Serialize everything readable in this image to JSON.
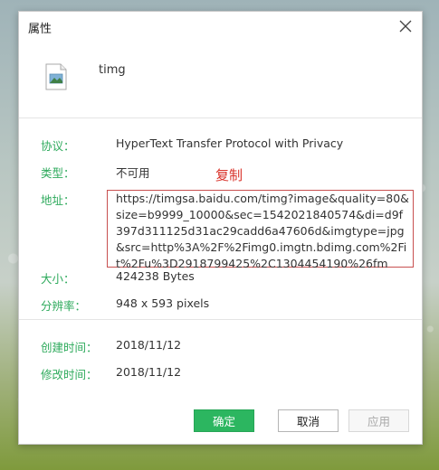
{
  "dialog": {
    "title": "属性",
    "file_name": "timg"
  },
  "properties": {
    "protocol": {
      "label": "协议：",
      "value": "HyperText Transfer Protocol with Privacy"
    },
    "type": {
      "label": "类型：",
      "value": "不可用"
    },
    "address": {
      "label": "地址：",
      "value": "https://timgsa.baidu.com/timg?image&quality=80&size=b9999_10000&sec=1542021840574&di=d9f397d311125d31ac29cadd6a47606d&imgtype=jpg&src=http%3A%2F%2Fimg0.imgtn.bdimg.com%2Fit%2Fu%3D2918799425%2C1304454190%26fm"
    },
    "size": {
      "label": "大小：",
      "value": "424238 Bytes"
    },
    "resolution": {
      "label": "分辨率：",
      "value": "948 x 593 pixels"
    },
    "created": {
      "label": "创建时间：",
      "value": "2018/11/12"
    },
    "modified": {
      "label": "修改时间：",
      "value": "2018/11/12"
    }
  },
  "annotation": {
    "copy_label": "复制"
  },
  "buttons": {
    "ok": "确定",
    "cancel": "取消",
    "apply": "应用"
  },
  "colors": {
    "label_green": "#2eaa5c",
    "ok_green": "#2cb660",
    "annotation_red": "#d9332a"
  },
  "icons": {
    "close": "close-icon",
    "file": "image-file-icon"
  }
}
